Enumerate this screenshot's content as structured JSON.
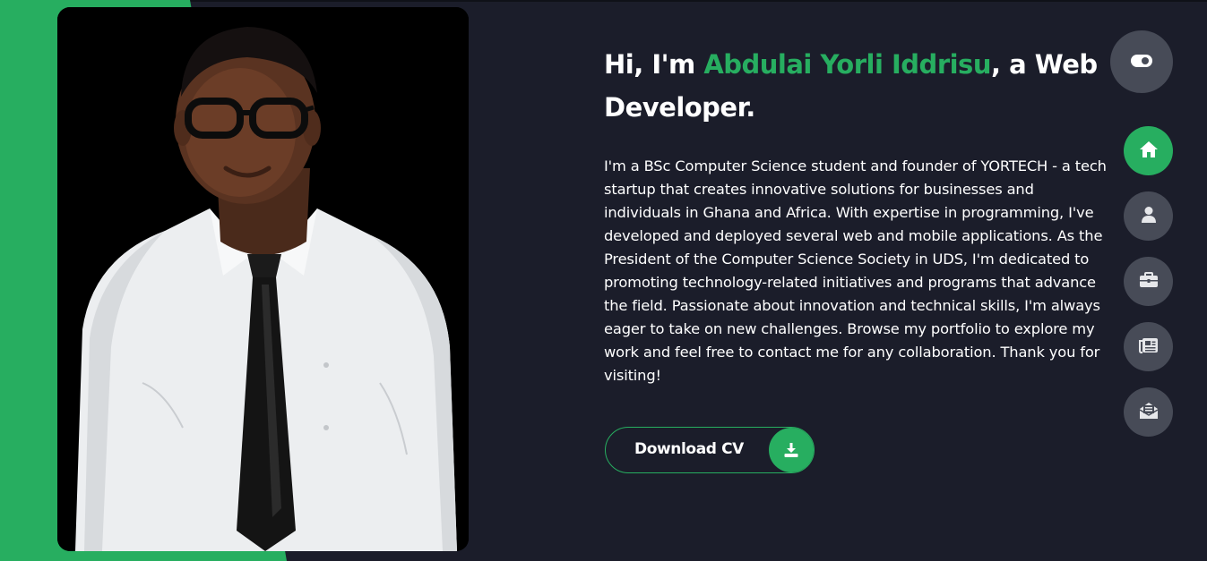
{
  "hero": {
    "greeting_prefix": "Hi, I'm ",
    "name": "Abdulai Yorli Iddrisu",
    "greeting_suffix": ", a Web Developer.",
    "bio": "I'm a BSc Computer Science student and founder of YORTECH - a tech startup that creates innovative solutions for businesses and individuals in Ghana and Africa. With expertise in programming, I've developed and deployed several web and mobile applications. As the President of the Computer Science Society in UDS, I'm dedicated to promoting technology-related initiatives and programs that advance the field. Passionate about innovation and technical skills, I'm always eager to take on new challenges. Browse my portfolio to explore my work and feel free to contact me for any collaboration. Thank you for visiting!",
    "cv_button_label": "Download CV",
    "cv_button_icon": "download-icon"
  },
  "theme_toggle": {
    "icon": "toggle-icon"
  },
  "nav": {
    "items": [
      {
        "name": "home",
        "icon": "home-icon",
        "active": true
      },
      {
        "name": "about",
        "icon": "user-icon",
        "active": false
      },
      {
        "name": "portfolio",
        "icon": "briefcase-icon",
        "active": false
      },
      {
        "name": "blog",
        "icon": "newspaper-icon",
        "active": false
      },
      {
        "name": "contact",
        "icon": "envelope-open-icon",
        "active": false
      }
    ]
  },
  "colors": {
    "background": "#1b1d2a",
    "accent": "#27ae60",
    "button_grey": "#474b57",
    "text": "#ffffff"
  }
}
